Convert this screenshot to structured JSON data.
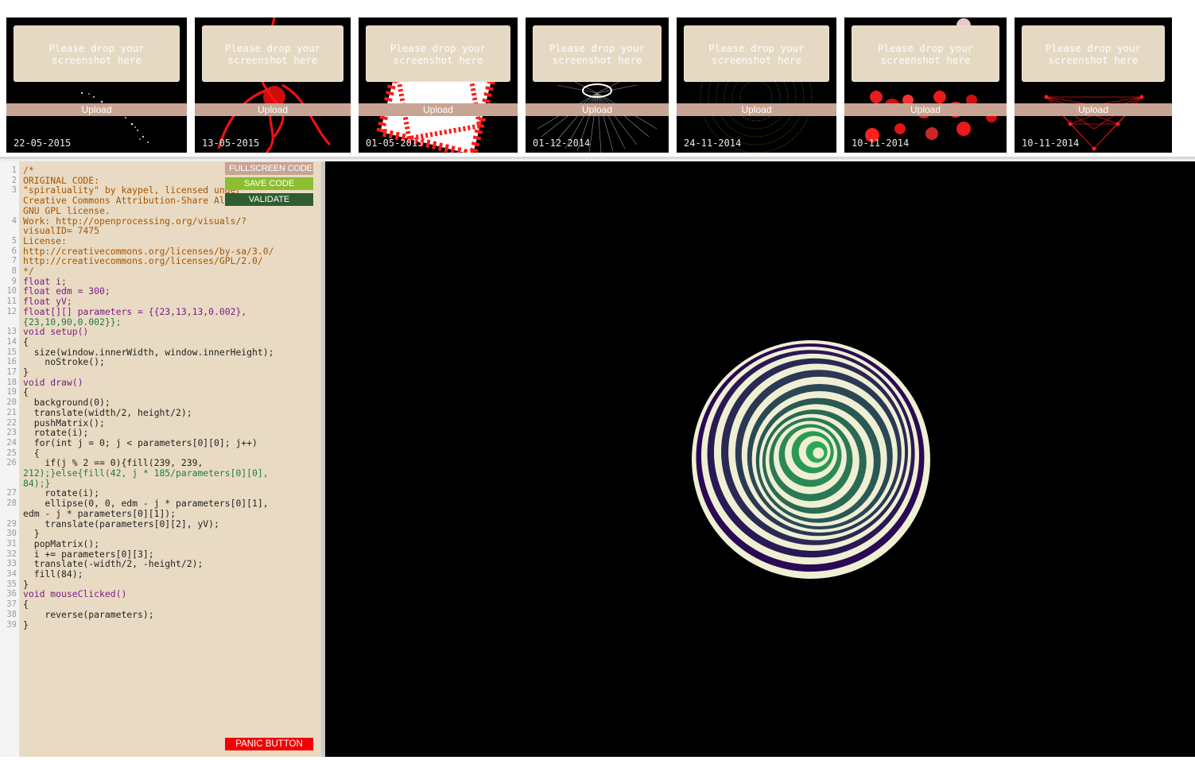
{
  "thumbnails": [
    {
      "drop_text": "Please drop your screenshot here",
      "upload_label": "Upload",
      "date": "22-05-2015",
      "art": "sparkle-trail"
    },
    {
      "drop_text": "Please drop your screenshot here",
      "upload_label": "Upload",
      "date": "13-05-2015",
      "art": "red-smoke"
    },
    {
      "drop_text": "Please drop your screenshot here",
      "upload_label": "Upload",
      "date": "01-05-2015",
      "art": "red-stripe-squares"
    },
    {
      "drop_text": "Please drop your screenshot here",
      "upload_label": "Upload",
      "date": "01-12-2014",
      "art": "grey-ribbon-fan"
    },
    {
      "drop_text": "Please drop your screenshot here",
      "upload_label": "Upload",
      "date": "24-11-2014",
      "art": "green-dot-rings"
    },
    {
      "drop_text": "Please drop your screenshot here",
      "upload_label": "Upload",
      "date": "10-11-2014",
      "art": "red-bubbles"
    },
    {
      "drop_text": "Please drop your screenshot here",
      "upload_label": "Upload",
      "date": "10-11-2014",
      "art": "red-wire-mesh"
    }
  ],
  "editor": {
    "buttons": {
      "fullscreen": "FULLSCREEN CODE",
      "save": "SAVE CODE",
      "validate": "VALIDATE",
      "panic": "PANIC BUTTON"
    },
    "line_numbers": [
      "1",
      "2",
      "3",
      "4",
      "5",
      "6",
      "7",
      "8",
      "9",
      "10",
      "11",
      "12",
      "13",
      "14",
      "15",
      "16",
      "17",
      "18",
      "19",
      "20",
      "21",
      "22",
      "23",
      "24",
      "25",
      "26",
      "27",
      "28",
      "29",
      "30",
      "31",
      "32",
      "33",
      "34",
      "35",
      "36",
      "37",
      "38",
      "39"
    ],
    "code_lines": [
      "/*",
      "ORIGINAL CODE:",
      "\"spiraluality\" by kaypel, licensed under",
      "Creative Commons Attribution-Share Alike 3.0 and",
      "GNU GPL license.",
      "Work: http://openprocessing.org/visuals/?",
      "visualID= 7475",
      "License:",
      "http://creativecommons.org/licenses/by-sa/3.0/",
      "http://creativecommons.org/licenses/GPL/2.0/",
      "*/",
      "float i;",
      "float edm = 300;",
      "float yV;",
      "float[][] parameters = {{23,13,13,0.002},",
      "{23,10,90,0.002}};",
      "void setup()",
      "{",
      "  size(window.innerWidth, window.innerHeight);",
      "    noStroke();",
      "}",
      "void draw()",
      "{",
      "  background(0);",
      "  translate(width/2, height/2);",
      "  pushMatrix();",
      "  rotate(i);",
      "  for(int j = 0; j < parameters[0][0]; j++)",
      "  {",
      "    if(j % 2 == 0){fill(239, 239,",
      "212);}else{fill(42, j * 185/parameters[0][0],",
      "84);}",
      "    rotate(i);",
      "    ellipse(0, 0, edm - j * parameters[0][1],",
      "edm - j * parameters[0][1]);",
      "    translate(parameters[0][2], yV);",
      "  }",
      "  popMatrix();",
      "  i += parameters[0][3];",
      "  translate(-width/2, -height/2);",
      "  fill(84);",
      "}",
      "void mouseClicked()",
      "{",
      "    reverse(parameters);",
      "}"
    ]
  },
  "sketch": {
    "background": "#000000",
    "light_fill": "#efefd4",
    "dark_fill_start": "#2a0054",
    "accent_green": "#2a9a54"
  }
}
